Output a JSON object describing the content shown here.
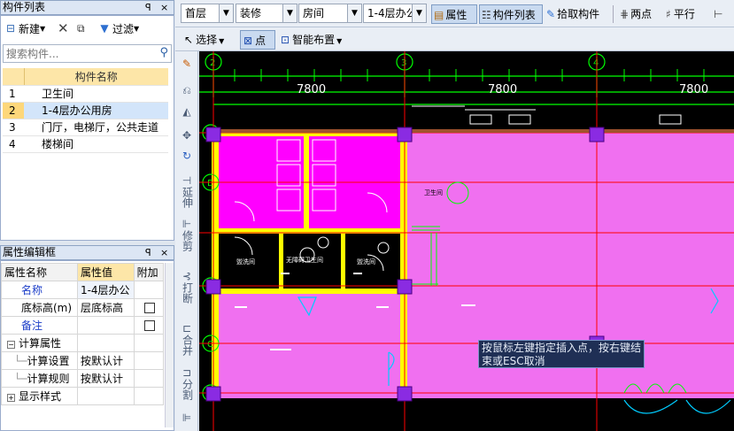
{
  "component_list": {
    "title": "构件列表",
    "pin": "ᵖ",
    "close": "×",
    "new_label": "新建",
    "filter_label": "过滤",
    "search_placeholder": "搜索构件...",
    "column_header": "构件名称",
    "rows": [
      {
        "num": "1",
        "name": "卫生间"
      },
      {
        "num": "2",
        "name": "1-4层办公用房"
      },
      {
        "num": "3",
        "name": "门厅，电梯厅，公共走道"
      },
      {
        "num": "4",
        "name": "楼梯间"
      }
    ],
    "selected_index": 1
  },
  "property_editor": {
    "title": "属性编辑框",
    "headers": [
      "属性名称",
      "属性值",
      "附加"
    ],
    "rows": [
      {
        "name": "名称",
        "value": "1-4层办公"
      },
      {
        "name": "底标高(m)",
        "value": "层底标高"
      },
      {
        "name": "备注",
        "value": ""
      },
      {
        "name": "计算属性",
        "value": ""
      },
      {
        "name": "计算设置",
        "value": "按默认计"
      },
      {
        "name": "计算规则",
        "value": "按默认计"
      },
      {
        "name": "显示样式",
        "value": ""
      }
    ]
  },
  "toolbar": {
    "floor": "首层",
    "category": "装修",
    "type": "房间",
    "component": "1-4层办公",
    "properties_label": "属性",
    "component_list_label": "构件列表",
    "pick_label": "拾取构件",
    "two_points_label": "两点",
    "parallel_label": "平行"
  },
  "toolbar2": {
    "select_label": "选择",
    "point_label": "点",
    "smart_layout_label": "智能布置"
  },
  "vertical_tools": {
    "extend": "延伸",
    "trim": "修剪",
    "break": "打断",
    "merge": "合并",
    "split": "分割"
  },
  "canvas": {
    "dimensions": [
      "7800",
      "7800",
      "7800"
    ],
    "axis_labels": [
      "2",
      "3",
      "4",
      "E",
      "D",
      "C"
    ],
    "room_labels": [
      "卫生间",
      "无障碍卫生间",
      "盥洗间",
      "盥洗间"
    ],
    "tooltip": "按鼠标左键指定插入点，按右键结束或ESC取消"
  },
  "colors": {
    "canvas_bg": "#000000",
    "room_fill": "#ff00ff",
    "room_fill_light": "#f070f0",
    "wall": "#ffff00",
    "axis_line": "#ff0000",
    "dim_line": "#00ff00",
    "column": "#8a2be2"
  }
}
